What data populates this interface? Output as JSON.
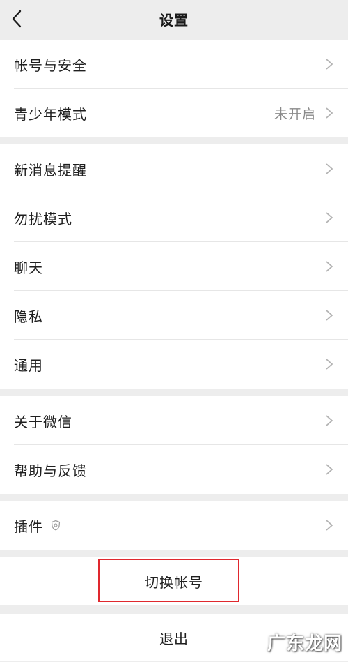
{
  "header": {
    "title": "设置",
    "back_icon": "chevron-left-icon"
  },
  "group1": [
    {
      "label": "帐号与安全"
    },
    {
      "label": "青少年模式",
      "value": "未开启"
    }
  ],
  "group2": [
    {
      "label": "新消息提醒"
    },
    {
      "label": "勿扰模式"
    },
    {
      "label": "聊天"
    },
    {
      "label": "隐私"
    },
    {
      "label": "通用"
    }
  ],
  "group3": [
    {
      "label": "关于微信"
    },
    {
      "label": "帮助与反馈"
    }
  ],
  "group4": [
    {
      "label": "插件",
      "icon": "plugin-shield-icon"
    }
  ],
  "actions": {
    "switch_account": "切换帐号",
    "logout": "退出"
  },
  "watermark": "广东龙网",
  "colors": {
    "background": "#ededed",
    "card": "#ffffff",
    "highlight": "#e0282e",
    "secondary_text": "#8a8a8a"
  }
}
